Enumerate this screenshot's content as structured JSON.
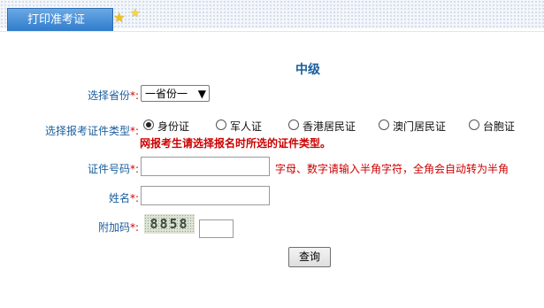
{
  "header": {
    "tab_label": "打印准考证"
  },
  "form": {
    "title": "中级",
    "province": {
      "label": "选择省份",
      "required_mark": "*:",
      "selected": "一省份一"
    },
    "cert_type": {
      "label": "选择报考证件类型",
      "required_mark": "*:",
      "options": [
        "身份证",
        "军人证",
        "香港居民证",
        "澳门居民证",
        "台胞证"
      ],
      "selected_index": 0,
      "warning": "网报考生请选择报名时所选的证件类型。"
    },
    "id_number": {
      "label": "证件号码",
      "required_mark": "*:",
      "hint": "字母、数字请输入半角字符，全角会自动转为半角"
    },
    "name": {
      "label": "姓名",
      "required_mark": "*:"
    },
    "captcha": {
      "label": "附加码",
      "required_mark": "*:",
      "code": "8858"
    },
    "submit_label": "查询"
  }
}
